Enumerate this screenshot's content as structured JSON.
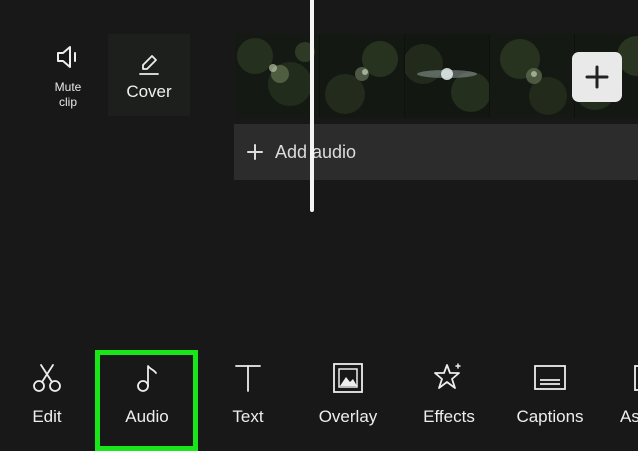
{
  "clip_controls": {
    "mute_label": "Mute\nclip",
    "cover_label": "Cover"
  },
  "timeline": {
    "add_audio_label": "Add audio"
  },
  "toolbar": {
    "items": [
      {
        "label": "Edit",
        "icon": "scissors-icon"
      },
      {
        "label": "Audio",
        "icon": "music-note-icon",
        "highlighted": true
      },
      {
        "label": "Text",
        "icon": "text-icon"
      },
      {
        "label": "Overlay",
        "icon": "overlay-icon"
      },
      {
        "label": "Effects",
        "icon": "effects-star-icon"
      },
      {
        "label": "Captions",
        "icon": "captions-icon"
      },
      {
        "label": "As",
        "icon": "aspect-ratio-icon"
      }
    ]
  },
  "colors": {
    "background": "#181818",
    "highlight": "#19e619",
    "add_audio_bar": "#2c2c2c",
    "add_clip_button": "#e9e9e9"
  }
}
